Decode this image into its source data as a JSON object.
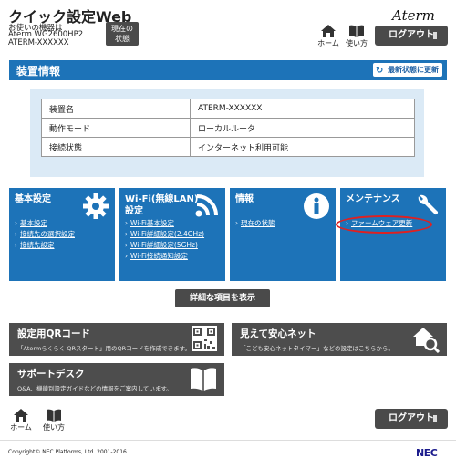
{
  "header": {
    "title": "クイック設定Web",
    "device_lines": [
      "お使いの機器は",
      "Aterm WG2600HP2",
      "ATERM-XXXXXX"
    ],
    "status_button": [
      "現在の",
      "状態"
    ],
    "brand": "Aterm",
    "nav": {
      "home": "ホーム",
      "help": "使い方"
    },
    "logout": "ログアウト"
  },
  "device_info": {
    "title": "装置情報",
    "refresh": "最新状態に更新",
    "rows": [
      {
        "key": "装置名",
        "value": "ATERM-XXXXXX"
      },
      {
        "key": "動作モード",
        "value": "ローカルルータ"
      },
      {
        "key": "接続状態",
        "value": "インターネット利用可能"
      }
    ]
  },
  "tiles": [
    {
      "title_lines": [
        "基本設定"
      ],
      "links": [
        "基本設定",
        "接続先の選択設定",
        "接続先設定"
      ],
      "icon": "gear-icon"
    },
    {
      "title_lines": [
        "Wi-Fi(無線LAN)",
        "設定"
      ],
      "links": [
        "Wi-Fi基本設定",
        "Wi-Fi詳細設定(2.4GHz)",
        "Wi-Fi詳細設定(5GHz)",
        "Wi-Fi接続通知設定"
      ],
      "icon": "wifi-icon"
    },
    {
      "title_lines": [
        "情報"
      ],
      "links": [
        "現在の状態"
      ],
      "icon": "info-icon"
    },
    {
      "title_lines": [
        "メンテナンス"
      ],
      "links": [
        "ファームウェア更新"
      ],
      "icon": "wrench-icon"
    }
  ],
  "detail_button": "詳細な項目を表示",
  "cards": {
    "qr": {
      "title": "設定用QRコード",
      "desc": "「Atermらくらく QRスタート」用のQRコードを作成できます。",
      "icon": "qr-code-icon"
    },
    "safe_net": {
      "title": "見えて安心ネット",
      "desc": "「こども安心ネットタイマー」などの設定はこちらから。",
      "icon": "house-search-icon"
    },
    "support": {
      "title": "サポートデスク",
      "desc": "Q&A、機能別設定ガイドなどの情報をご案内しています。",
      "icon": "book-icon"
    }
  },
  "footer": {
    "nav": {
      "home": "ホーム",
      "help": "使い方"
    },
    "logout": "ログアウト",
    "copyright": "Copyright© NEC Platforms, Ltd. 2001-2016",
    "brand": "NEC"
  },
  "colors": {
    "primary": "#1d73b8",
    "panel": "#dbeaf6",
    "dark_button": "#4a4a4a",
    "highlight": "#e02020"
  }
}
